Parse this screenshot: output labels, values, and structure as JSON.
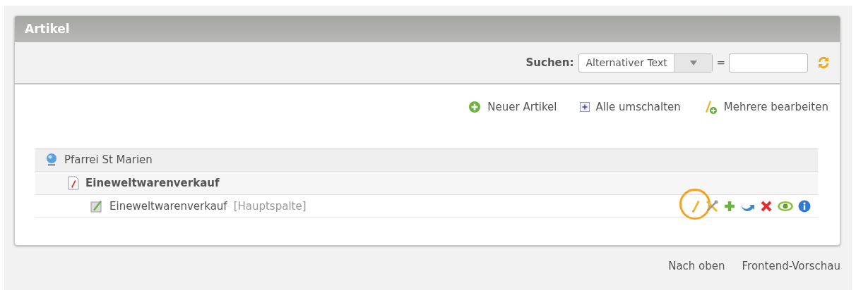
{
  "panel": {
    "title": "Artikel"
  },
  "search": {
    "label": "Suchen:",
    "field": "Alternativer Text",
    "operator": "="
  },
  "toolbar": [
    {
      "kind": "new",
      "label": "Neuer Artikel"
    },
    {
      "kind": "toggle",
      "label": "Alle umschalten"
    },
    {
      "kind": "multi",
      "label": "Mehrere bearbeiten"
    }
  ],
  "tree": [
    {
      "kind": "site",
      "label": "Pfarrei St Marien",
      "children": [
        {
          "kind": "article",
          "label": "Eineweltwarenverkauf",
          "children": [
            {
              "kind": "element",
              "label": "Eineweltwarenverkauf",
              "tag": "[Hauptspalte]",
              "actions": [
                {
                  "kind": "edit",
                  "highlighted": true
                },
                {
                  "kind": "tools",
                  "highlighted": false
                },
                {
                  "kind": "add",
                  "highlighted": false
                },
                {
                  "kind": "move",
                  "highlighted": false
                },
                {
                  "kind": "delete",
                  "highlighted": false
                },
                {
                  "kind": "view",
                  "highlighted": false
                },
                {
                  "kind": "info",
                  "highlighted": false
                }
              ]
            }
          ]
        }
      ]
    }
  ],
  "footer": [
    "Nach oben",
    "Frontend-Vorschau"
  ]
}
